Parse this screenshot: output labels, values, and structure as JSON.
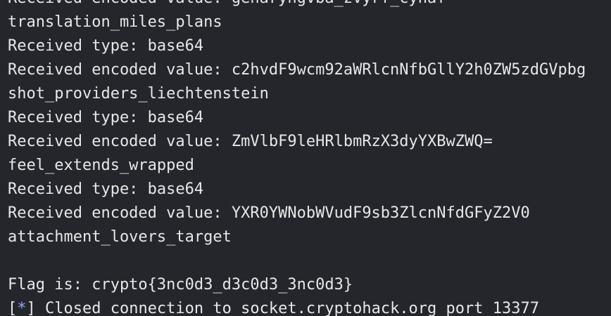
{
  "terminal": {
    "lines": [
      "Received encoded value: genaryngvba_zvyrf_cynaf",
      "translation_miles_plans",
      "Received type: base64",
      "Received encoded value: c2hvdF9wcm92aWRlcnNfbGllY2h0ZW5zdGVpbg",
      "shot_providers_liechtenstein",
      "Received type: base64",
      "Received encoded value: ZmVlbF9leHRlbmRzX3dyYXBwZWQ=",
      "feel_extends_wrapped",
      "Received type: base64",
      "Received encoded value: YXR0YWNobWVudF9sb3ZlcnNfdGFyZ2V0",
      "attachment_lovers_target",
      "",
      "Flag is: crypto{3nc0d3_d3c0d3_3nc0d3}"
    ],
    "status_line": {
      "bracket_open": "[",
      "star": "*",
      "bracket_close": "]",
      "text": " Closed connection to socket.cryptohack.org port 13377"
    }
  }
}
